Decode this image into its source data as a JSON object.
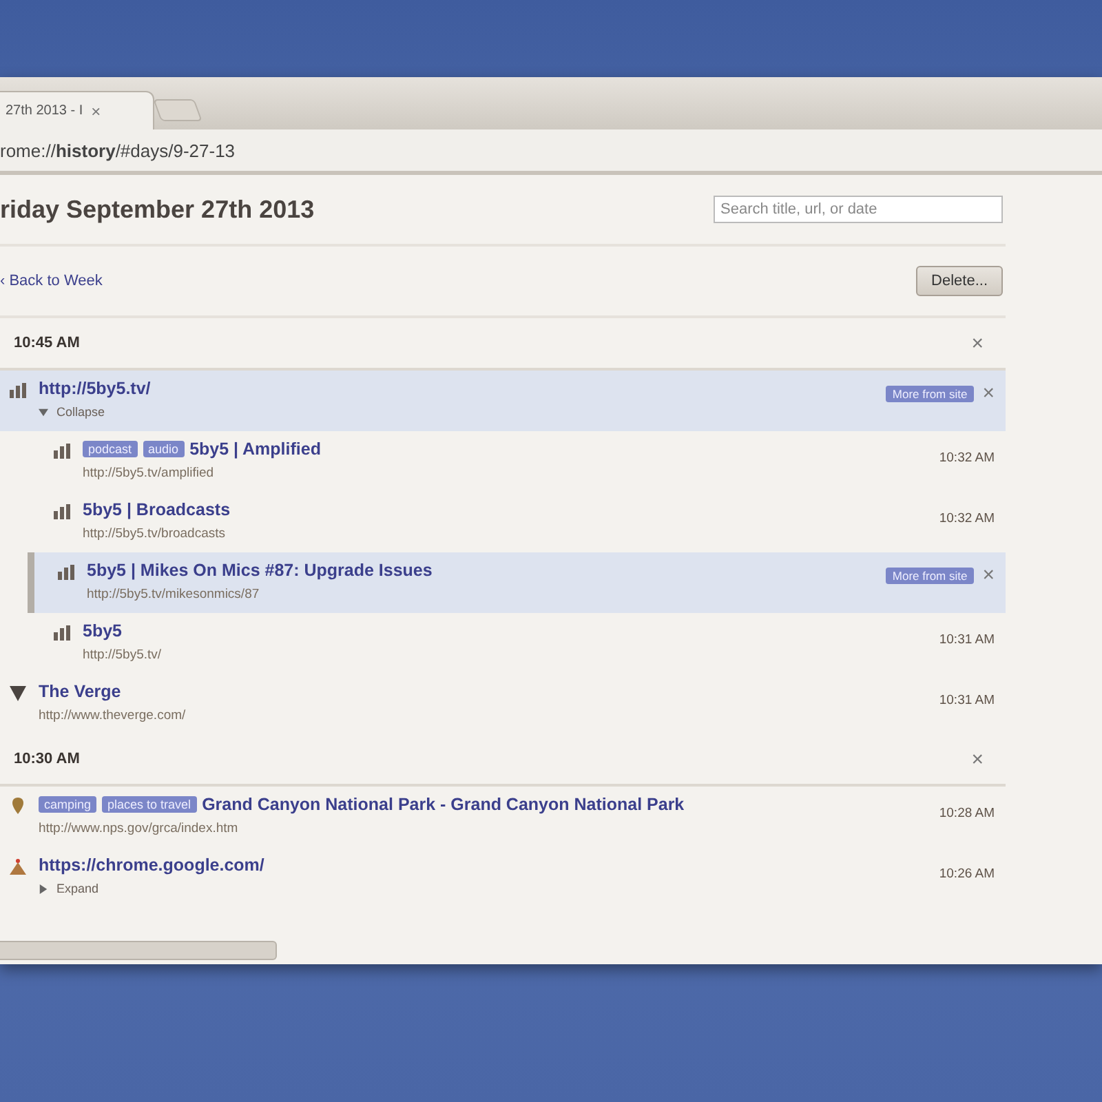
{
  "tab": {
    "title": "27th 2013 - I",
    "close": "×"
  },
  "address": {
    "prefix": "rome://",
    "bold": "history",
    "suffix": "/#days/9-27-13"
  },
  "heading": "riday September 27th 2013",
  "search": {
    "placeholder": "Search title, url, or date"
  },
  "back_link": "‹ Back to Week",
  "delete_button": "Delete...",
  "groups": [
    {
      "time": "10:45 AM",
      "close": "×",
      "entries": [
        {
          "kind": "domain",
          "icon": {
            "kind": "bars"
          },
          "title": "http://5by5.tv/",
          "toggle": "Collapse",
          "expanded": true,
          "selected": true,
          "more": "More from site",
          "close": "×",
          "children": [
            {
              "kind": "page",
              "icon": {
                "kind": "bars"
              },
              "tags": [
                "podcast",
                "audio"
              ],
              "title": "5by5 | Amplified",
              "url": "http://5by5.tv/amplified",
              "time": "10:32 AM",
              "selected": false
            },
            {
              "kind": "page",
              "icon": {
                "kind": "bars"
              },
              "title": "5by5 | Broadcasts",
              "url": "http://5by5.tv/broadcasts",
              "time": "10:32 AM",
              "selected": false
            },
            {
              "kind": "page",
              "icon": {
                "kind": "bars"
              },
              "title": "5by5 | Mikes On Mics #87: Upgrade Issues",
              "url": "http://5by5.tv/mikesonmics/87",
              "selected": true,
              "more": "More from site",
              "close": "×"
            },
            {
              "kind": "page",
              "icon": {
                "kind": "bars"
              },
              "title": "5by5",
              "url": "http://5by5.tv/",
              "time": "10:31 AM",
              "selected": false
            }
          ]
        },
        {
          "kind": "page",
          "icon": {
            "kind": "triangle"
          },
          "title": "The Verge",
          "url": "http://www.theverge.com/",
          "time": "10:31 AM",
          "selected": false
        }
      ]
    },
    {
      "time": "10:30 AM",
      "close": "×",
      "entries": [
        {
          "kind": "page",
          "icon": {
            "kind": "pin"
          },
          "tags": [
            "camping",
            "places to travel"
          ],
          "title": "Grand Canyon National Park - Grand Canyon National Park",
          "url": "http://www.nps.gov/grca/index.htm",
          "time": "10:28 AM",
          "selected": false
        },
        {
          "kind": "domain",
          "icon": {
            "kind": "cake"
          },
          "title": "https://chrome.google.com/",
          "toggle": "Expand",
          "expanded": false,
          "selected": false,
          "time": "10:26 AM"
        }
      ]
    }
  ]
}
